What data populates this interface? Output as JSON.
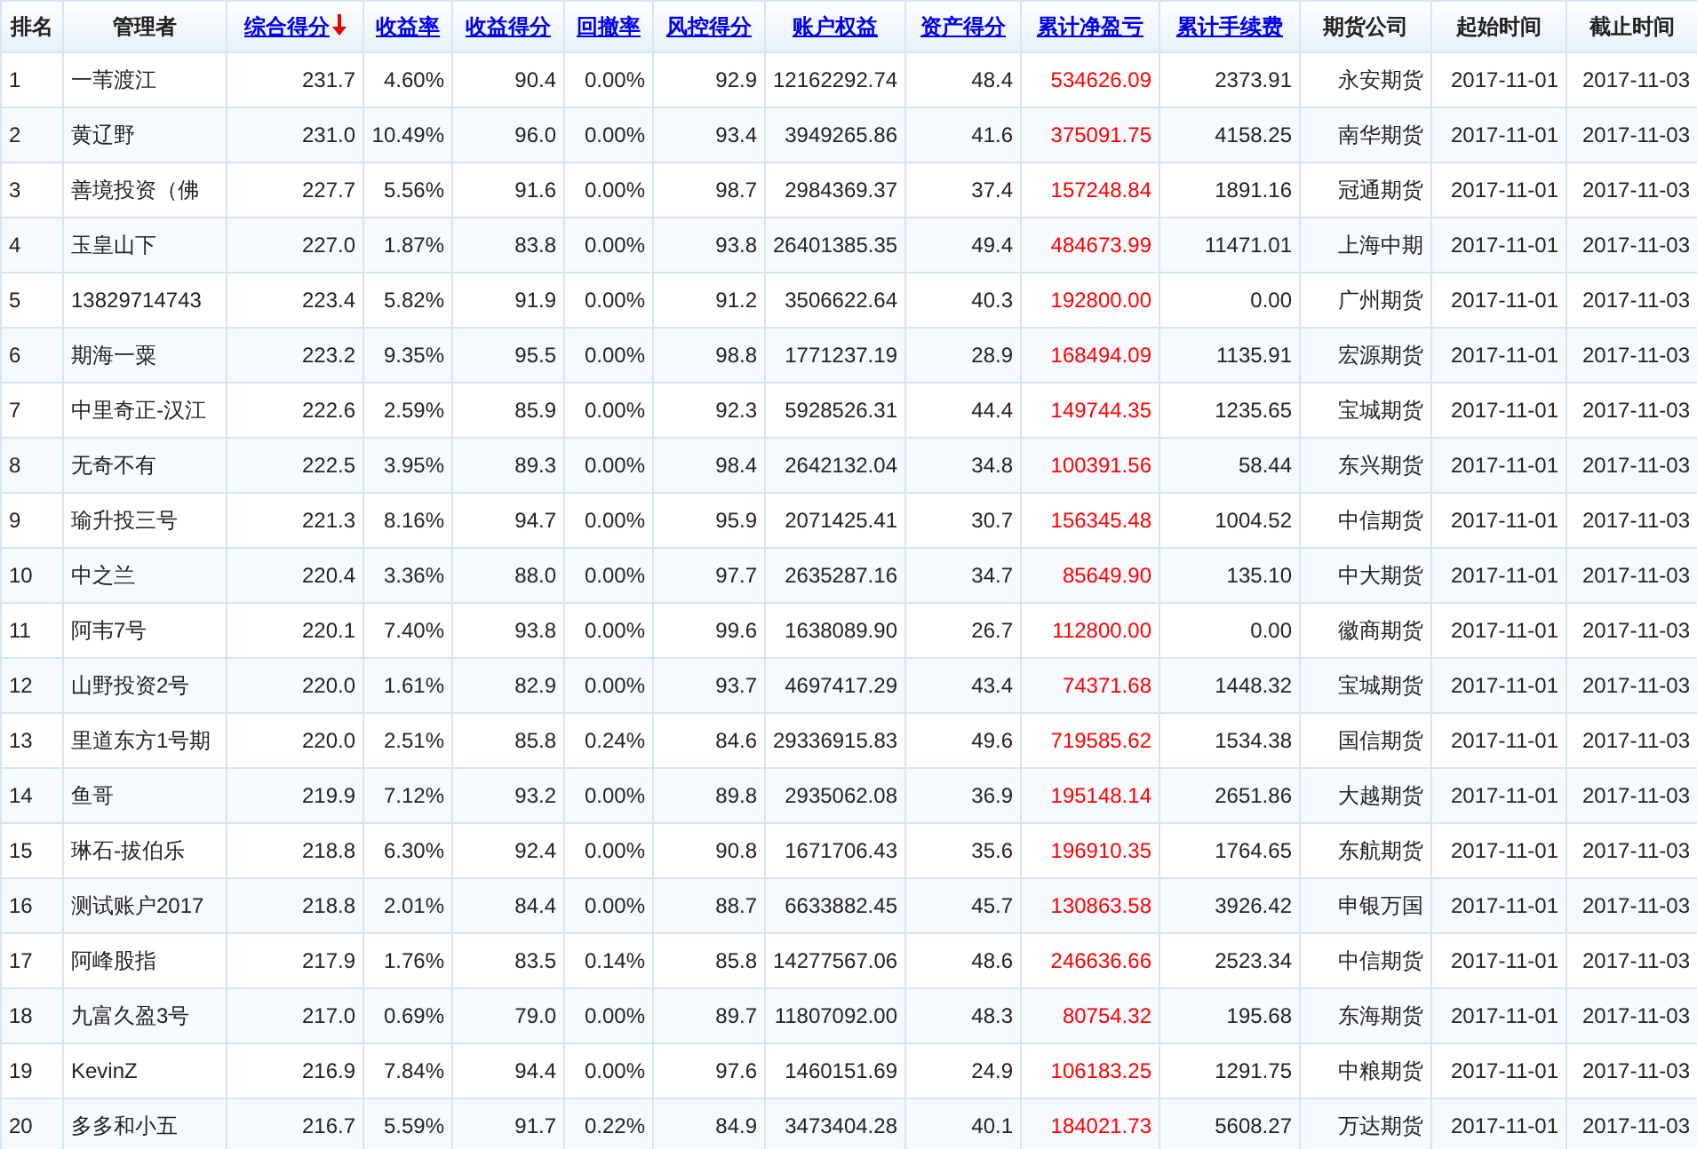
{
  "table": {
    "columns": [
      {
        "label": "排名",
        "kind": "plain"
      },
      {
        "label": "管理者",
        "kind": "plain"
      },
      {
        "label": "综合得分",
        "kind": "link",
        "sorted": true
      },
      {
        "label": "收益率",
        "kind": "link"
      },
      {
        "label": "收益得分",
        "kind": "link"
      },
      {
        "label": "回撤率",
        "kind": "link"
      },
      {
        "label": "风控得分",
        "kind": "link"
      },
      {
        "label": "账户权益",
        "kind": "link"
      },
      {
        "label": "资产得分",
        "kind": "link"
      },
      {
        "label": "累计净盈亏",
        "kind": "link",
        "color": "#ff0000"
      },
      {
        "label": "累计手续费",
        "kind": "link"
      },
      {
        "label": "期货公司",
        "kind": "plain"
      },
      {
        "label": "起始时间",
        "kind": "plain"
      },
      {
        "label": "截止时间",
        "kind": "plain"
      }
    ],
    "rows": [
      [
        "1",
        "一苇渡江",
        "231.7",
        "4.60%",
        "90.4",
        "0.00%",
        "92.9",
        "12162292.74",
        "48.4",
        "534626.09",
        "2373.91",
        "永安期货",
        "2017-11-01",
        "2017-11-03"
      ],
      [
        "2",
        "黄辽野",
        "231.0",
        "10.49%",
        "96.0",
        "0.00%",
        "93.4",
        "3949265.86",
        "41.6",
        "375091.75",
        "4158.25",
        "南华期货",
        "2017-11-01",
        "2017-11-03"
      ],
      [
        "3",
        "善境投资（佛",
        "227.7",
        "5.56%",
        "91.6",
        "0.00%",
        "98.7",
        "2984369.37",
        "37.4",
        "157248.84",
        "1891.16",
        "冠通期货",
        "2017-11-01",
        "2017-11-03"
      ],
      [
        "4",
        "玉皇山下",
        "227.0",
        "1.87%",
        "83.8",
        "0.00%",
        "93.8",
        "26401385.35",
        "49.4",
        "484673.99",
        "11471.01",
        "上海中期",
        "2017-11-01",
        "2017-11-03"
      ],
      [
        "5",
        "13829714743",
        "223.4",
        "5.82%",
        "91.9",
        "0.00%",
        "91.2",
        "3506622.64",
        "40.3",
        "192800.00",
        "0.00",
        "广州期货",
        "2017-11-01",
        "2017-11-03"
      ],
      [
        "6",
        "期海一粟",
        "223.2",
        "9.35%",
        "95.5",
        "0.00%",
        "98.8",
        "1771237.19",
        "28.9",
        "168494.09",
        "1135.91",
        "宏源期货",
        "2017-11-01",
        "2017-11-03"
      ],
      [
        "7",
        "中里奇正-汉江",
        "222.6",
        "2.59%",
        "85.9",
        "0.00%",
        "92.3",
        "5928526.31",
        "44.4",
        "149744.35",
        "1235.65",
        "宝城期货",
        "2017-11-01",
        "2017-11-03"
      ],
      [
        "8",
        "无奇不有",
        "222.5",
        "3.95%",
        "89.3",
        "0.00%",
        "98.4",
        "2642132.04",
        "34.8",
        "100391.56",
        "58.44",
        "东兴期货",
        "2017-11-01",
        "2017-11-03"
      ],
      [
        "9",
        "瑜升投三号",
        "221.3",
        "8.16%",
        "94.7",
        "0.00%",
        "95.9",
        "2071425.41",
        "30.7",
        "156345.48",
        "1004.52",
        "中信期货",
        "2017-11-01",
        "2017-11-03"
      ],
      [
        "10",
        "中之兰",
        "220.4",
        "3.36%",
        "88.0",
        "0.00%",
        "97.7",
        "2635287.16",
        "34.7",
        "85649.90",
        "135.10",
        "中大期货",
        "2017-11-01",
        "2017-11-03"
      ],
      [
        "11",
        "阿韦7号",
        "220.1",
        "7.40%",
        "93.8",
        "0.00%",
        "99.6",
        "1638089.90",
        "26.7",
        "112800.00",
        "0.00",
        "徽商期货",
        "2017-11-01",
        "2017-11-03"
      ],
      [
        "12",
        "山野投资2号",
        "220.0",
        "1.61%",
        "82.9",
        "0.00%",
        "93.7",
        "4697417.29",
        "43.4",
        "74371.68",
        "1448.32",
        "宝城期货",
        "2017-11-01",
        "2017-11-03"
      ],
      [
        "13",
        "里道东方1号期",
        "220.0",
        "2.51%",
        "85.8",
        "0.24%",
        "84.6",
        "29336915.83",
        "49.6",
        "719585.62",
        "1534.38",
        "国信期货",
        "2017-11-01",
        "2017-11-03"
      ],
      [
        "14",
        "鱼哥",
        "219.9",
        "7.12%",
        "93.2",
        "0.00%",
        "89.8",
        "2935062.08",
        "36.9",
        "195148.14",
        "2651.86",
        "大越期货",
        "2017-11-01",
        "2017-11-03"
      ],
      [
        "15",
        "琳石-拔伯乐",
        "218.8",
        "6.30%",
        "92.4",
        "0.00%",
        "90.8",
        "1671706.43",
        "35.6",
        "196910.35",
        "1764.65",
        "东航期货",
        "2017-11-01",
        "2017-11-03"
      ],
      [
        "16",
        "测试账户2017",
        "218.8",
        "2.01%",
        "84.4",
        "0.00%",
        "88.7",
        "6633882.45",
        "45.7",
        "130863.58",
        "3926.42",
        "申银万国",
        "2017-11-01",
        "2017-11-03"
      ],
      [
        "17",
        "阿峰股指",
        "217.9",
        "1.76%",
        "83.5",
        "0.14%",
        "85.8",
        "14277567.06",
        "48.6",
        "246636.66",
        "2523.34",
        "中信期货",
        "2017-11-01",
        "2017-11-03"
      ],
      [
        "18",
        "九富久盈3号",
        "217.0",
        "0.69%",
        "79.0",
        "0.00%",
        "89.7",
        "11807092.00",
        "48.3",
        "80754.32",
        "195.68",
        "东海期货",
        "2017-11-01",
        "2017-11-03"
      ],
      [
        "19",
        "KevinZ",
        "216.9",
        "7.84%",
        "94.4",
        "0.00%",
        "97.6",
        "1460151.69",
        "24.9",
        "106183.25",
        "1291.75",
        "中粮期货",
        "2017-11-01",
        "2017-11-03"
      ],
      [
        "20",
        "多多和小五",
        "216.7",
        "5.59%",
        "91.7",
        "0.22%",
        "84.9",
        "3473404.28",
        "40.1",
        "184021.73",
        "5608.27",
        "万达期货",
        "2017-11-01",
        "2017-11-03"
      ]
    ]
  }
}
